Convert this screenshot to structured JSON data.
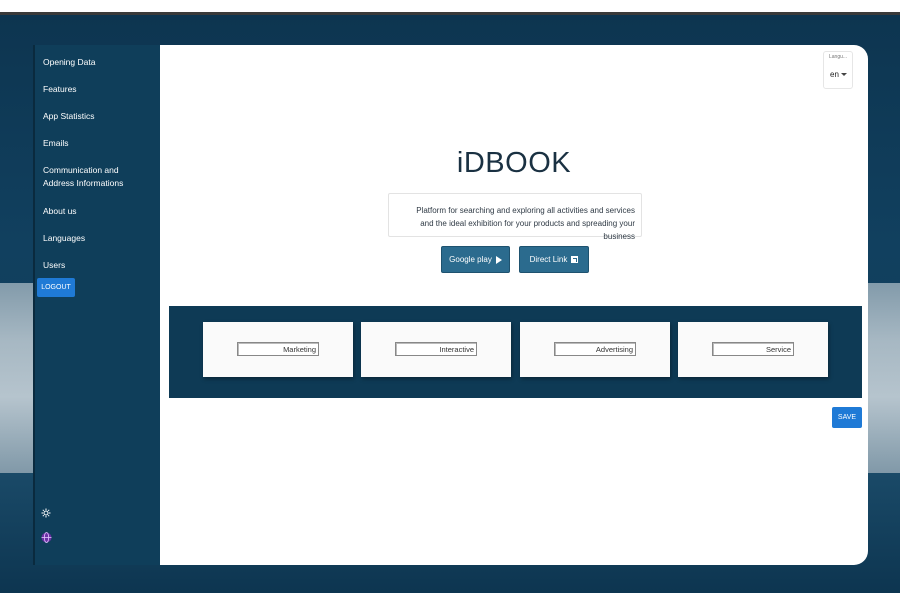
{
  "sidebar": {
    "items": [
      {
        "label": "Opening Data"
      },
      {
        "label": "Features"
      },
      {
        "label": "App Statistics"
      },
      {
        "label": "Emails"
      },
      {
        "label": "Communication and Address Informations"
      },
      {
        "label": "About us"
      },
      {
        "label": "Languages"
      },
      {
        "label": "Users"
      }
    ],
    "logout_label": "LOGOUT",
    "bottom_icons": [
      "settings-icon",
      "globe-icon"
    ]
  },
  "language": {
    "label": "Langu...",
    "value": "en"
  },
  "brand": {
    "name": "iDBOOK",
    "tagline_line1": "Platform for searching and exploring all activities and services",
    "tagline_line2": "and the ideal exhibition for your products and spreading your business"
  },
  "buttons": {
    "google_play": "Google play",
    "direct_link": "Direct Link",
    "save": "SAVE"
  },
  "cards": [
    {
      "value": "Marketing"
    },
    {
      "value": "Interactive"
    },
    {
      "value": "Advertising"
    },
    {
      "value": "Service"
    }
  ],
  "colors": {
    "accent": "#1f7ad6",
    "sidebar": "#0f3e5a",
    "store_button": "#2b6b8e",
    "cards_band": "#0e3a55"
  }
}
